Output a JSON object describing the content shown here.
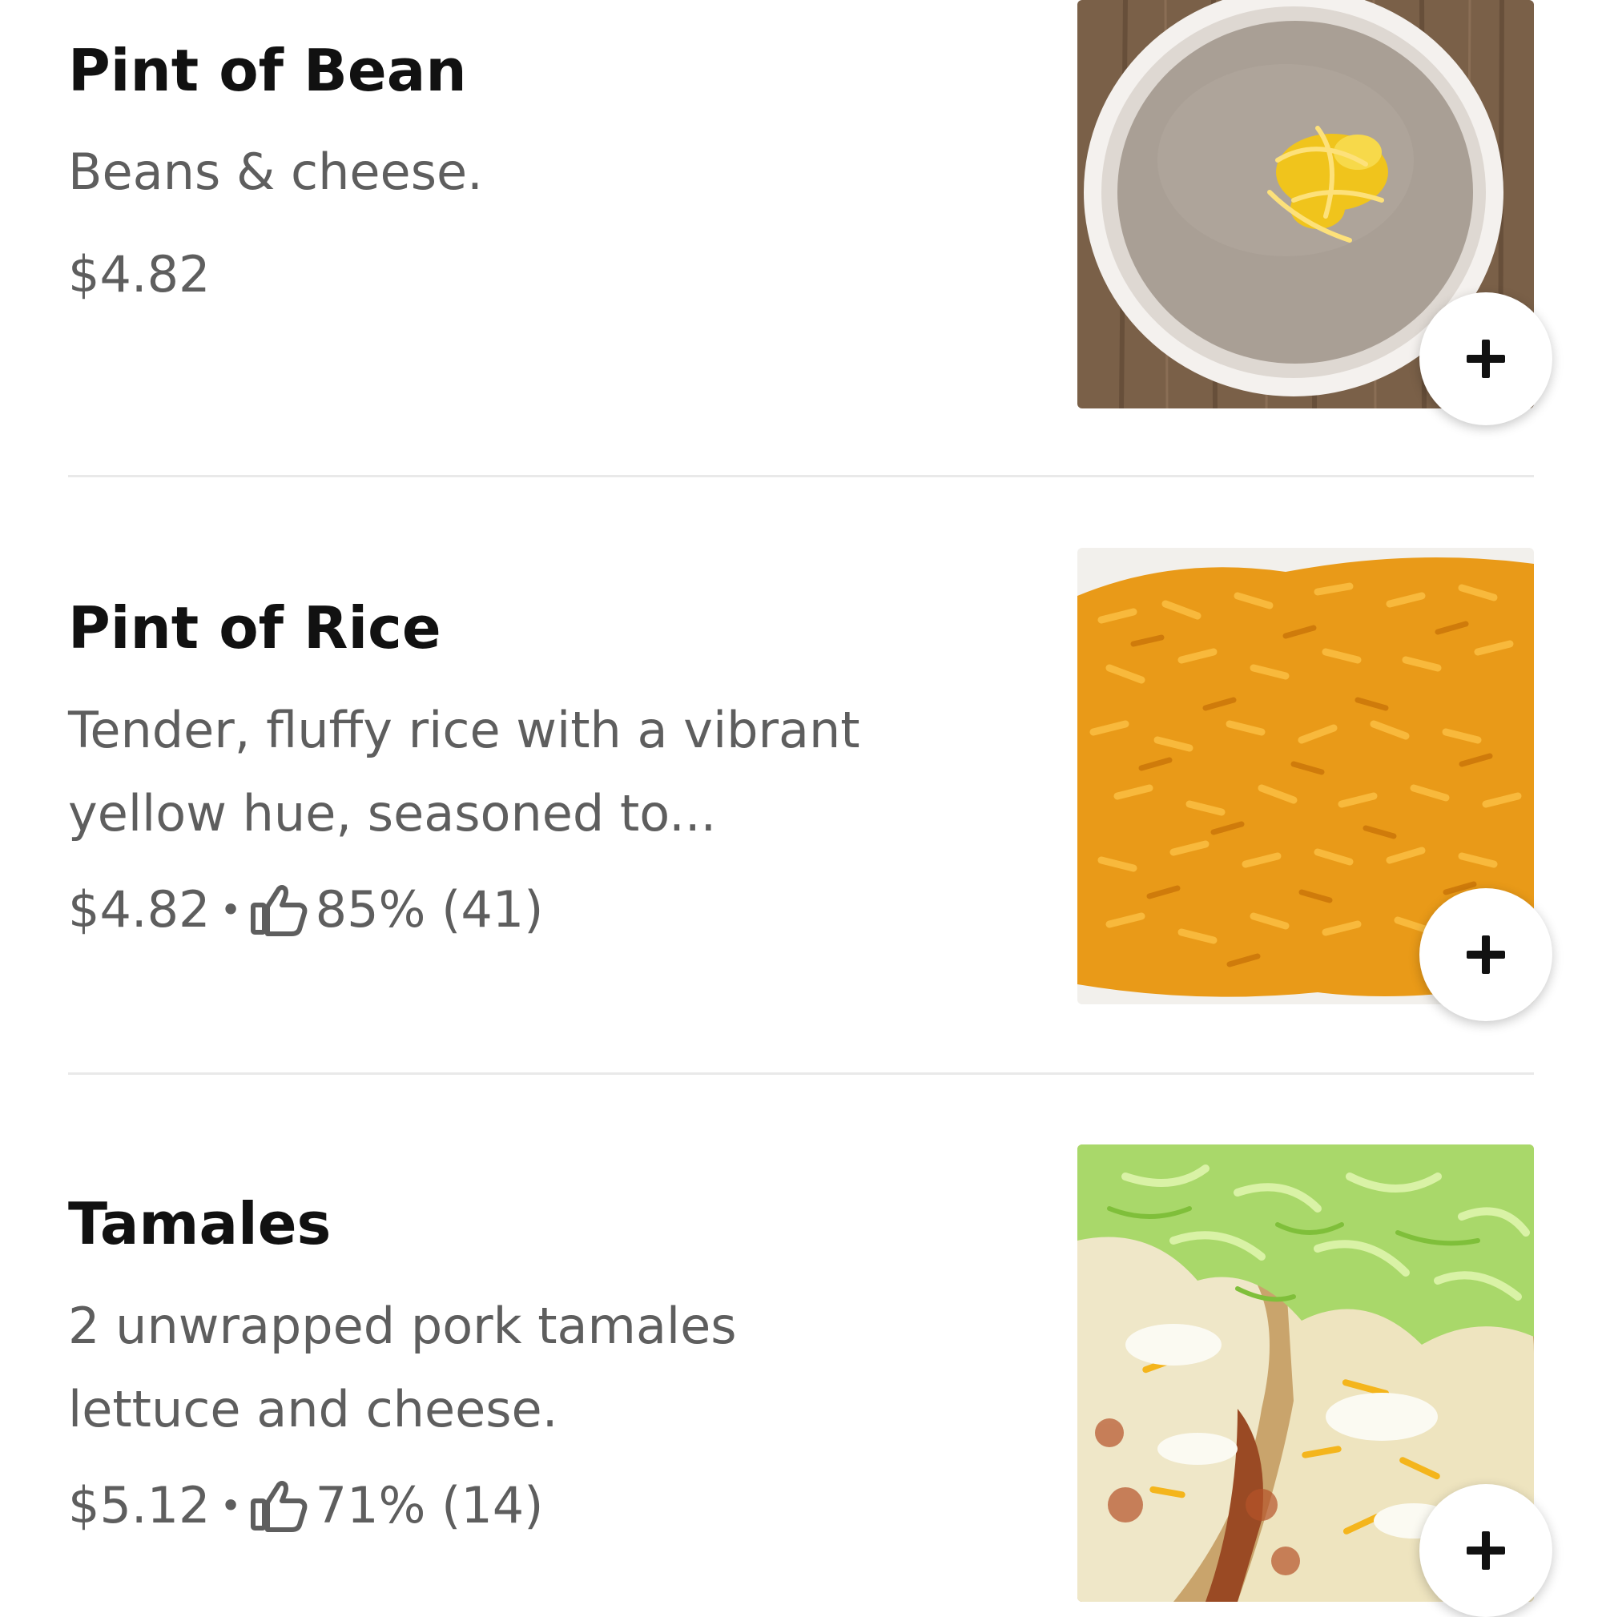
{
  "menu_items": [
    {
      "title": "Pint of Bean",
      "description": "Beans & cheese.",
      "price": "$4.82",
      "separator": "",
      "rating": "",
      "add_icon": "plus-icon",
      "photo": "beans-with-cheese"
    },
    {
      "title": "Pint of Rice",
      "description": "Tender, fluffy rice with a vibrant yellow hue, seasoned to...",
      "price": "$4.82",
      "separator": "•",
      "rating": "85% (41)",
      "rating_icon": "thumbs-up-icon",
      "add_icon": "plus-icon",
      "photo": "yellow-rice"
    },
    {
      "title": "Tamales",
      "description": "2 unwrapped pork tamales lettuce and cheese.",
      "price": "$5.12",
      "separator": "•",
      "rating": "71% (14)",
      "rating_icon": "thumbs-up-icon",
      "add_icon": "plus-icon",
      "photo": "tamales-with-lettuce"
    }
  ],
  "colors": {
    "title": "#111111",
    "secondary_text": "#5e5e5e",
    "divider": "#e9e9e9",
    "background": "#ffffff"
  }
}
